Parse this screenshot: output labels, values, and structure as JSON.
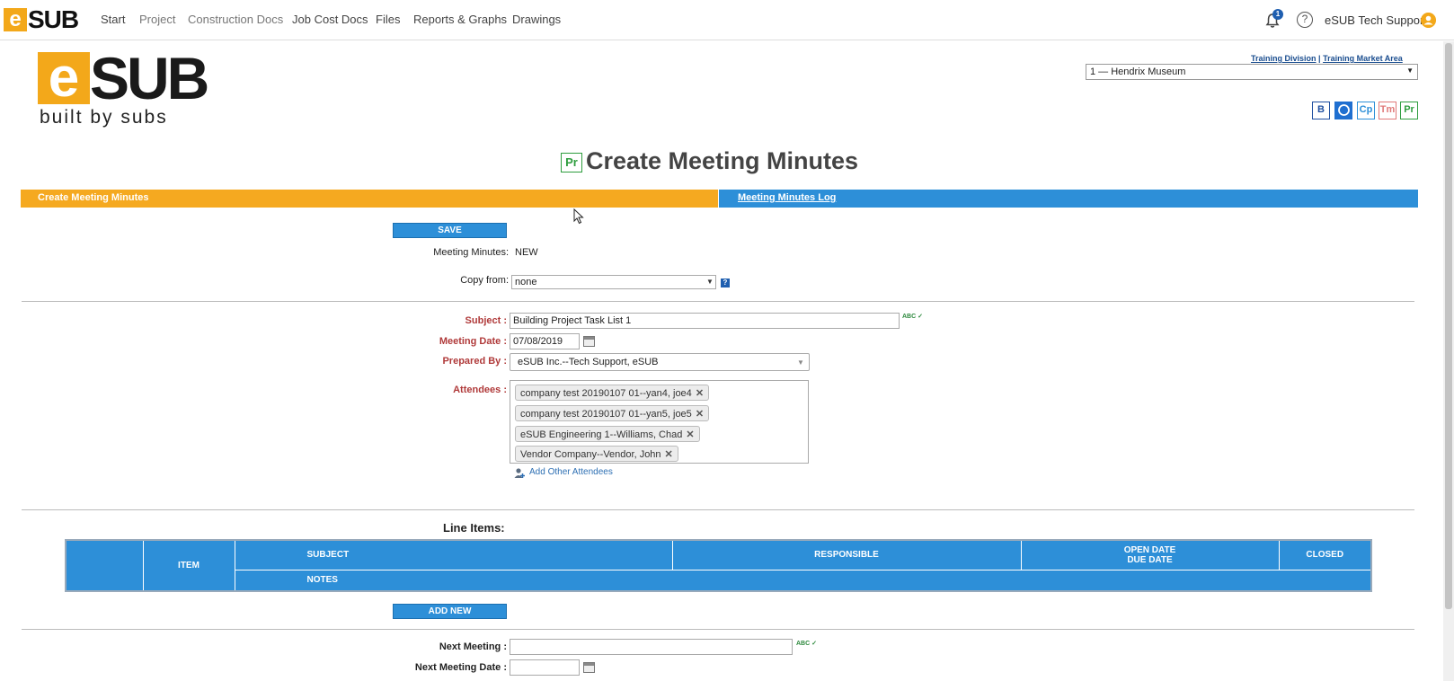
{
  "nav": {
    "logo_letter": "e",
    "logo_text": "SUB",
    "items": [
      "Start",
      "Project",
      "Construction Docs",
      "Job Cost Docs",
      "Files",
      "Reports & Graphs",
      "Drawings"
    ],
    "notification_count": "1",
    "help_glyph": "?",
    "user_name": "eSUB Tech Support"
  },
  "brand": {
    "logo_letter": "e",
    "logo_text": "SUB",
    "tagline": "built by subs",
    "accent_color": "#f5a920"
  },
  "division": {
    "division_link": "Training Division",
    "separator": "|",
    "market_link": "Training Market Area",
    "project_selected": "1 — Hendrix Museum"
  },
  "module_buttons": [
    {
      "label": "B",
      "color": "#1f4fa0"
    },
    {
      "label": "",
      "color": "#1f6fd0"
    },
    {
      "label": "Cp",
      "color": "#2d8fd8"
    },
    {
      "label": "Tm",
      "color": "#e07a7a"
    },
    {
      "label": "Pr",
      "color": "#2e9d3e"
    }
  ],
  "page": {
    "title_icon": "Pr",
    "title": "Create Meeting Minutes"
  },
  "tabs": {
    "active": "Create Meeting Minutes",
    "log": "Meeting Minutes Log"
  },
  "form": {
    "save_label": "SAVE",
    "meeting_minutes_label": "Meeting Minutes:",
    "meeting_minutes_value": "NEW",
    "copy_from_label": "Copy from:",
    "copy_from_value": "none",
    "help_glyph": "?",
    "subject_label": "Subject :",
    "subject_value": "Building Project Task List 1",
    "meeting_date_label": "Meeting Date :",
    "meeting_date_value": "07/08/2019",
    "prepared_by_label": "Prepared By :",
    "prepared_by_value": "eSUB Inc.--Tech Support, eSUB",
    "attendees_label": "Attendees :",
    "attendees": [
      "company test 20190107 01--yan4, joe4",
      "company test 20190107 01--yan5, joe5",
      "eSUB Engineering 1--Williams, Chad",
      "Vendor Company--Vendor, John"
    ],
    "add_attendees_label": "Add Other Attendees",
    "spell_glyph": "ABC"
  },
  "line_items": {
    "title": "Line Items:",
    "headers": {
      "item": "ITEM",
      "subject": "SUBJECT",
      "responsible": "RESPONSIBLE",
      "open_date": "OPEN DATE",
      "due_date": "DUE DATE",
      "closed": "CLOSED",
      "notes": "NOTES"
    },
    "add_new_label": "ADD NEW"
  },
  "next": {
    "next_meeting_label": "Next Meeting :",
    "next_meeting_value": "",
    "next_meeting_date_label": "Next Meeting Date :",
    "next_meeting_date_value": ""
  }
}
